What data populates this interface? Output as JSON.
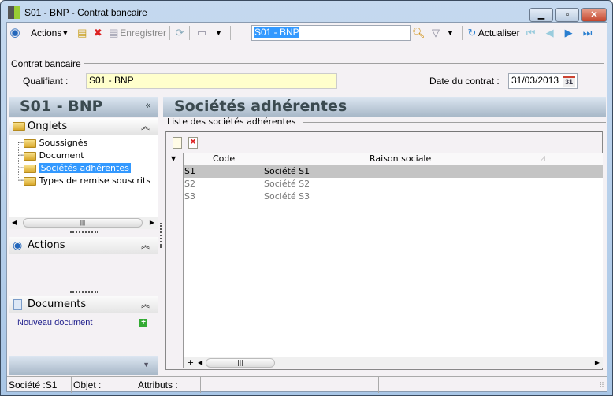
{
  "window": {
    "title": "S01 - BNP -  Contrat bancaire"
  },
  "toolbar": {
    "actions": "Actions",
    "save": "Enregistrer",
    "search_value": "S01 - BNP",
    "refresh": "Actualiser"
  },
  "form": {
    "group": "Contrat bancaire",
    "qualifiant_label": "Qualifiant :",
    "qualifiant_value": "S01 - BNP",
    "date_label": "Date du contrat :",
    "date_value": "31/03/2013",
    "calendar_day": "31"
  },
  "sidebar": {
    "title": "S01 - BNP",
    "collapse": "«",
    "onglets": "Onglets",
    "tabs": [
      "Soussignés",
      "Document",
      "Sociétés adhérentes",
      "Types de remise souscrits"
    ],
    "actions": "Actions",
    "documents": "Documents",
    "new_document": "Nouveau document"
  },
  "main": {
    "title": "Sociétés adhérentes",
    "group": "Liste des sociétés adhérentes",
    "columns": [
      "Code",
      "Raison sociale"
    ],
    "rows": [
      {
        "code": "S1",
        "name": "Société S1"
      },
      {
        "code": "S2",
        "name": "Société S2"
      },
      {
        "code": "S3",
        "name": "Société S3"
      }
    ],
    "add": "+"
  },
  "status": {
    "societe": "Société :S1",
    "objet": "Objet :",
    "attributs": "Attributs :"
  }
}
